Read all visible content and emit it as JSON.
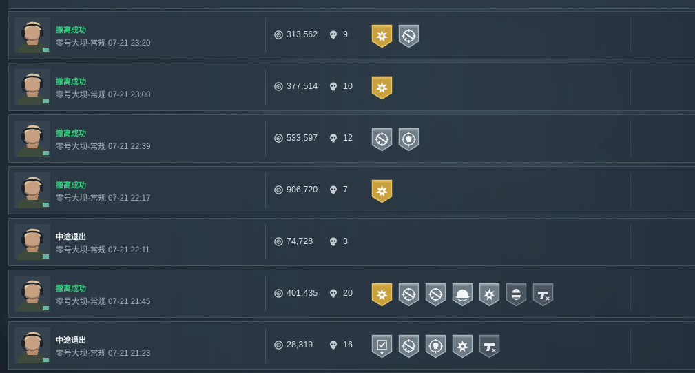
{
  "colors": {
    "success": "#35d07e",
    "quit": "#eef2f5",
    "gold_badge": "#c9a13e",
    "silver_badge": "#7d8a94"
  },
  "icons": {
    "value": "currency-coin-icon",
    "kills": "skull-icon"
  },
  "matches": [
    {
      "status": "撤离成功",
      "status_type": "success",
      "map_time": "零号大坝-常规 07-21 23:20",
      "value": "313,562",
      "kills": "9",
      "badges": [
        {
          "type": "gold",
          "icon": "star-burst"
        },
        {
          "type": "silver",
          "icon": "rifle-crosshair"
        }
      ]
    },
    {
      "status": "撤离成功",
      "status_type": "success",
      "map_time": "零号大坝-常规 07-21 23:00",
      "value": "377,514",
      "kills": "10",
      "badges": [
        {
          "type": "gold",
          "icon": "star-burst"
        }
      ]
    },
    {
      "status": "撤离成功",
      "status_type": "success",
      "map_time": "零号大坝-常规 07-21 22:39",
      "value": "533,597",
      "kills": "12",
      "badges": [
        {
          "type": "silver",
          "icon": "rifle-crosshair"
        },
        {
          "type": "silver",
          "icon": "skull-crosshair"
        }
      ]
    },
    {
      "status": "撤离成功",
      "status_type": "success",
      "map_time": "零号大坝-常规 07-21 22:17",
      "value": "906,720",
      "kills": "7",
      "badges": [
        {
          "type": "gold",
          "icon": "star-burst"
        }
      ]
    },
    {
      "status": "中途退出",
      "status_type": "quit",
      "map_time": "零号大坝-常规 07-21 22:11",
      "value": "74,728",
      "kills": "3",
      "badges": []
    },
    {
      "status": "撤离成功",
      "status_type": "success",
      "map_time": "零号大坝-常规 07-21 21:45",
      "value": "401,435",
      "kills": "20",
      "badges": [
        {
          "type": "gold",
          "icon": "star-burst"
        },
        {
          "type": "silver",
          "icon": "rifle-crosshair"
        },
        {
          "type": "silver",
          "icon": "rifle-crosshair"
        },
        {
          "type": "silver",
          "icon": "helmet"
        },
        {
          "type": "silver",
          "icon": "star-burst"
        },
        {
          "type": "dark",
          "icon": "masked-face"
        },
        {
          "type": "dark",
          "icon": "pistol"
        }
      ]
    },
    {
      "status": "中途退出",
      "status_type": "quit",
      "map_time": "零号大坝-常规 07-21 21:23",
      "value": "28,319",
      "kills": "16",
      "badges": [
        {
          "type": "silver",
          "icon": "checkbox-star"
        },
        {
          "type": "silver",
          "icon": "rifle-crosshair"
        },
        {
          "type": "silver",
          "icon": "skull-crosshair"
        },
        {
          "type": "silver",
          "icon": "star-burst"
        },
        {
          "type": "dark",
          "icon": "pistol"
        }
      ]
    }
  ]
}
